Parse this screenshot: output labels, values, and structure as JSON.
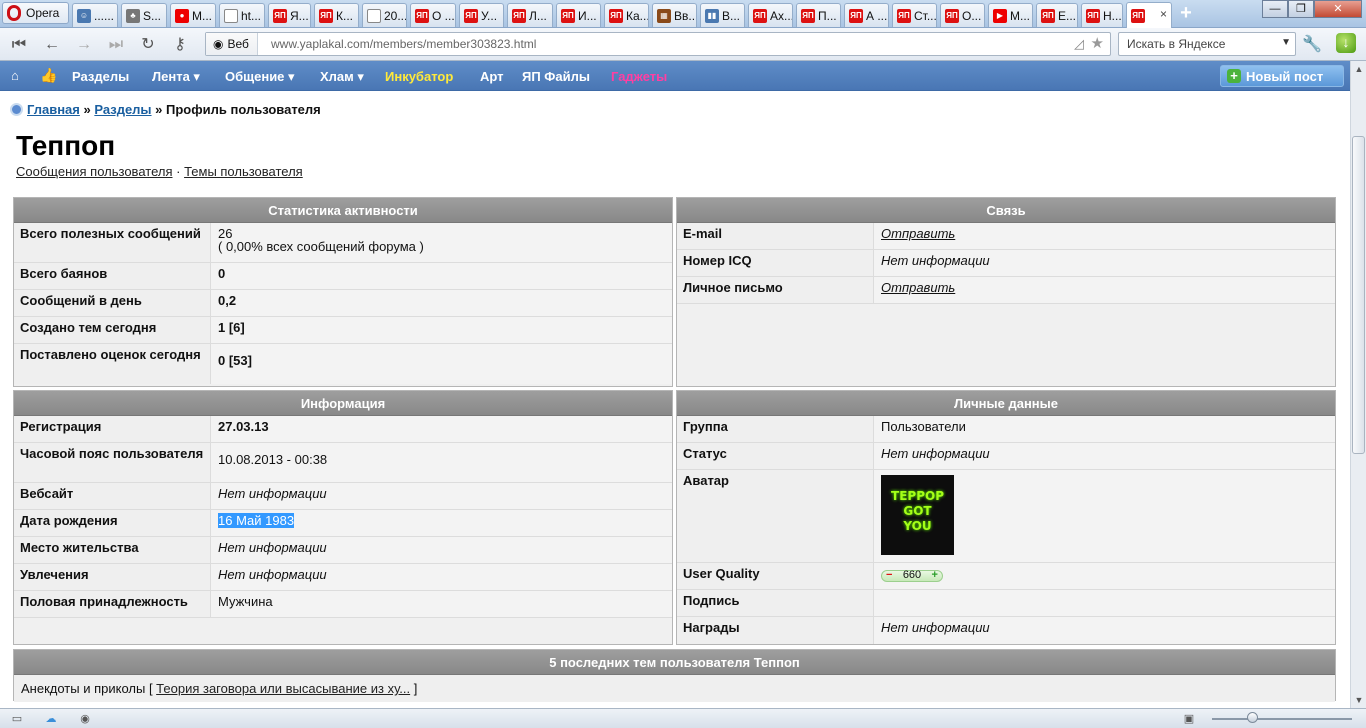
{
  "browser": {
    "menu_label": "Opera",
    "tabs": [
      {
        "title": "......",
        "icon": "user-icon"
      },
      {
        "title": "S...",
        "icon": "tree-icon"
      },
      {
        "title": "M...",
        "icon": "red-icon"
      },
      {
        "title": "ht...",
        "icon": "page-icon"
      },
      {
        "title": "Я...",
        "icon": "yap-icon"
      },
      {
        "title": "К...",
        "icon": "yap-icon"
      },
      {
        "title": "20...",
        "icon": "page-icon"
      },
      {
        "title": "О ...",
        "icon": "yap-icon"
      },
      {
        "title": "У...",
        "icon": "yap-icon"
      },
      {
        "title": "Л...",
        "icon": "yap-icon"
      },
      {
        "title": "И...",
        "icon": "yap-icon"
      },
      {
        "title": "Ка...",
        "icon": "yap-icon"
      },
      {
        "title": "Вв...",
        "icon": "brown-icon"
      },
      {
        "title": "В...",
        "icon": "pause-icon"
      },
      {
        "title": "Ах...",
        "icon": "yap-icon"
      },
      {
        "title": "П...",
        "icon": "yap-icon"
      },
      {
        "title": "А ...",
        "icon": "yap-icon"
      },
      {
        "title": "Ст...",
        "icon": "yap-icon"
      },
      {
        "title": "О...",
        "icon": "yap-icon"
      },
      {
        "title": "М...",
        "icon": "youtube-icon"
      },
      {
        "title": "Е...",
        "icon": "yap-icon"
      },
      {
        "title": "Н...",
        "icon": "yap-icon"
      },
      {
        "title": "",
        "icon": "yap-icon"
      }
    ],
    "favicon_text": "ЯП",
    "close_glyph": "×",
    "web_label": "Веб",
    "url": "www.yaplakal.com/members/member303823.html",
    "search_placeholder": "Искать в Яндексе"
  },
  "site_nav": {
    "items": [
      "Разделы",
      "Лента ▾",
      "Общение ▾",
      "Хлам ▾",
      "Инкубатор",
      "Арт",
      "ЯП Файлы",
      "Гаджеты"
    ],
    "new_post": "Новый пост"
  },
  "breadcrumb": {
    "home": "Главная",
    "sep1": " » ",
    "sections": "Разделы",
    "sep2": " » ",
    "current": "Профиль пользователя"
  },
  "profile": {
    "username": "Теппоп",
    "link_messages": "Сообщения пользователя",
    "link_sep": " · ",
    "link_topics": "Темы пользователя"
  },
  "stats": {
    "title": "Статистика активности",
    "rows": [
      {
        "label": "Всего полезных сообщений",
        "value": "26",
        "note": "( 0,00% всех сообщений форума )"
      },
      {
        "label": "Всего баянов",
        "value": "0"
      },
      {
        "label": "Сообщений в день",
        "value": "0,2"
      },
      {
        "label": "Создано тем сегодня",
        "value": "1 [6]"
      },
      {
        "label": "Поставлено оценок сегодня",
        "value": "0 [53]"
      }
    ]
  },
  "contact": {
    "title": "Связь",
    "rows": [
      {
        "label": "E-mail",
        "value": "Отправить"
      },
      {
        "label": "Номер ICQ",
        "value": "Нет информации"
      },
      {
        "label": "Личное письмо",
        "value": "Отправить"
      }
    ]
  },
  "info": {
    "title": "Информация",
    "rows": [
      {
        "label": "Регистрация",
        "value": "27.03.13"
      },
      {
        "label": "Часовой пояс пользователя",
        "value": "10.08.2013 - 00:38"
      },
      {
        "label": "Вебсайт",
        "value": "Нет информации"
      },
      {
        "label": "Дата рождения",
        "value": "16 Май 1983"
      },
      {
        "label": "Место жительства",
        "value": "Нет информации"
      },
      {
        "label": "Увлечения",
        "value": "Нет информации"
      },
      {
        "label": "Половая принадлежность",
        "value": "Мужчина"
      }
    ]
  },
  "personal": {
    "title": "Личные данные",
    "rows": [
      {
        "label": "Группа",
        "value": "Пользователи"
      },
      {
        "label": "Статус",
        "value": "Нет информации"
      },
      {
        "label": "Аватар",
        "value": ""
      },
      {
        "label": "User Quality",
        "value": "660"
      },
      {
        "label": "Подпись",
        "value": ""
      },
      {
        "label": "Награды",
        "value": "Нет информации"
      }
    ],
    "avatar_text": [
      "ТЕРРОР",
      "GOT",
      "YOU"
    ],
    "uq_minus": "−",
    "uq_plus": "+"
  },
  "last_topics": {
    "title": "5 последних тем пользователя Теппоп",
    "section": "Анекдоты и приколы",
    "open_bracket": " [ ",
    "topic": "Теория заговора или высасывание из ху...",
    "close_bracket": " ]"
  }
}
